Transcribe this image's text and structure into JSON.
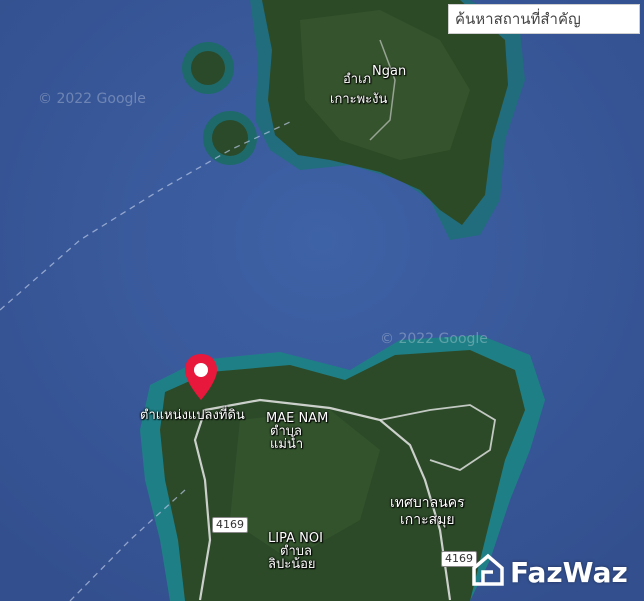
{
  "search": {
    "placeholder": "ค้นหาสถานที่สำคัญ"
  },
  "watermarks": [
    "© 2022 Google",
    "© 2022 Google"
  ],
  "places": {
    "ngan_en": "Ngan",
    "ngan_th1": "อำเภ",
    "ngan_th2": "เกาะพะงัน",
    "pin_label": "ตำแหน่งแปลงที่ดิน",
    "mae_nam_en": "MAE NAM",
    "mae_nam_th1": "ตำบล",
    "mae_nam_th2": "แม่น้ำ",
    "city_th1": "เทศบาลนคร",
    "city_th2": "เกาะสมุย",
    "lipa_en": "LIPA NOI",
    "lipa_th1": "ตำบล",
    "lipa_th2": "ลิปะน้อย"
  },
  "roads": [
    "4169",
    "4169"
  ],
  "brand": {
    "name": "FazWaz"
  },
  "colors": {
    "sea": "#3a5a9a",
    "pin": "#e8173c",
    "land": "#2c4a28",
    "reef": "#1f7f86"
  },
  "icons": {
    "pin": "map-pin-icon",
    "brand": "fazwaz-logo-icon"
  }
}
